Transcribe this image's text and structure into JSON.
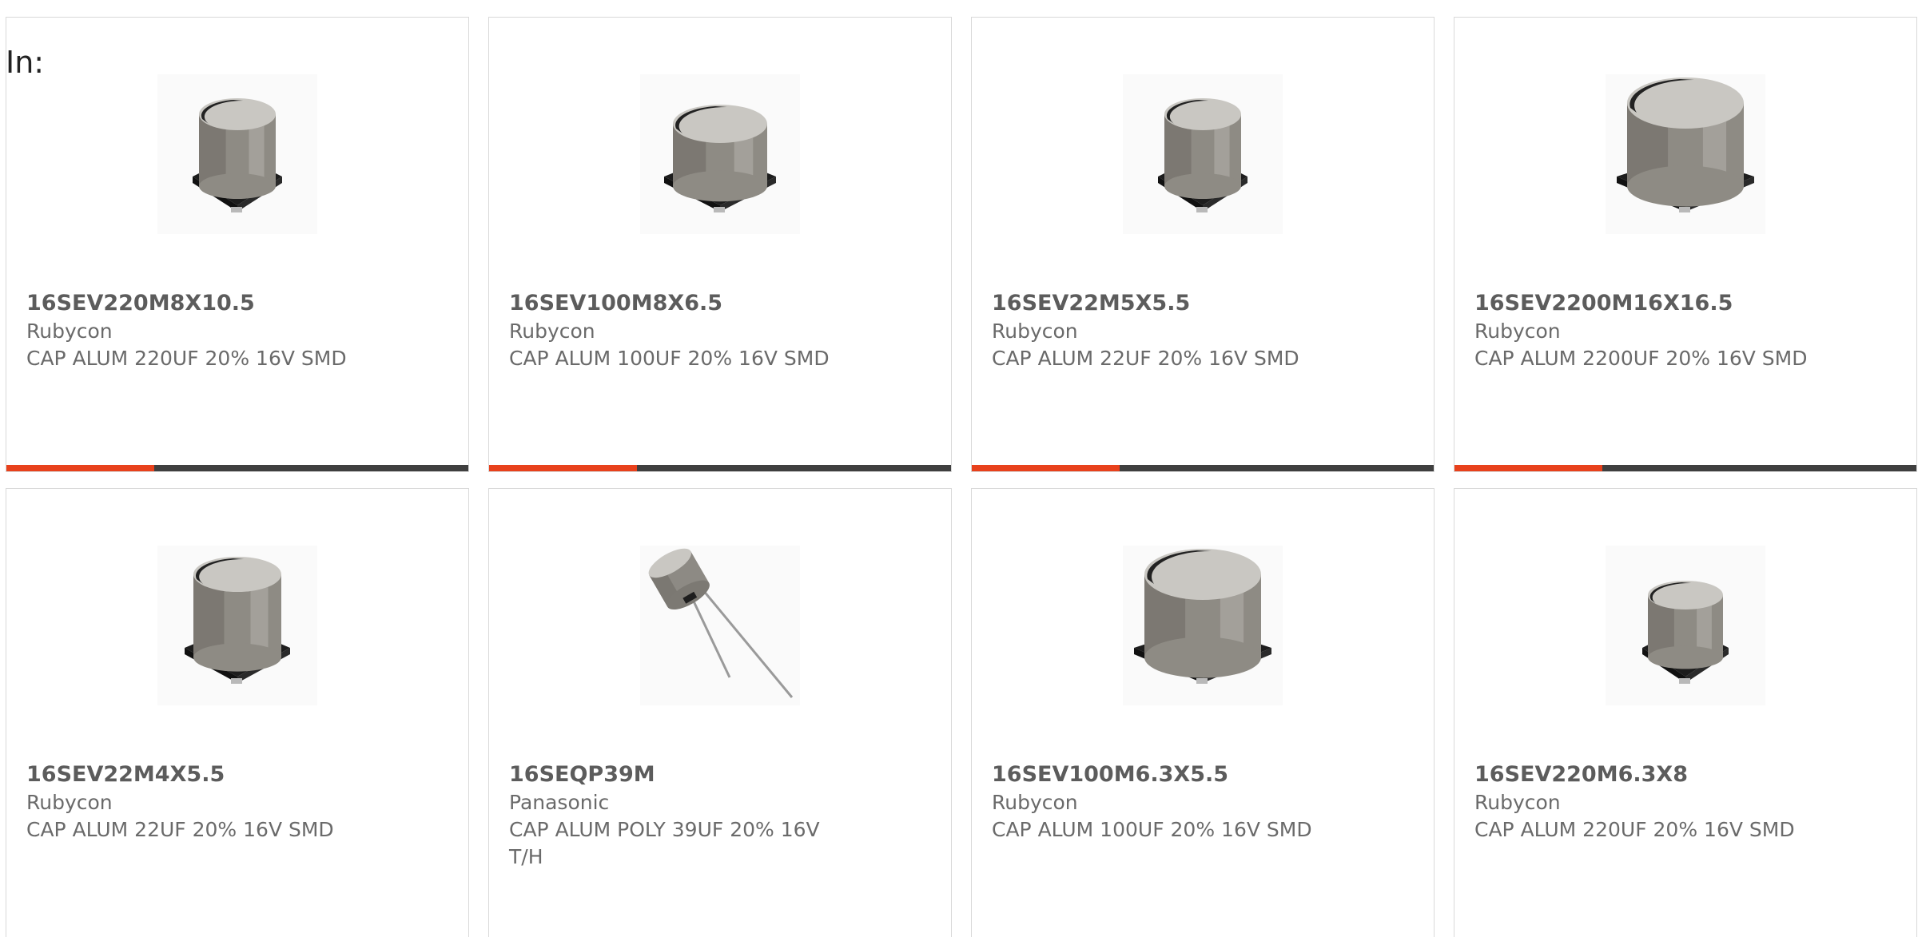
{
  "page": {
    "in_label": "In:"
  },
  "colors": {
    "accent": "#e8411c",
    "track": "#3f3f3f"
  },
  "products": [
    {
      "part": "16SEV220M8X10.5",
      "manufacturer": "Rubycon",
      "description": "CAP ALUM 220UF 20% 16V SMD",
      "image": "smd-capacitor-icon",
      "size": "medium",
      "progress": 0.32
    },
    {
      "part": "16SEV100M8X6.5",
      "manufacturer": "Rubycon",
      "description": "CAP ALUM 100UF 20% 16V SMD",
      "image": "smd-capacitor-icon",
      "size": "wide",
      "progress": 0.32
    },
    {
      "part": "16SEV22M5X5.5",
      "manufacturer": "Rubycon",
      "description": "CAP ALUM 22UF 20% 16V SMD",
      "image": "smd-capacitor-icon",
      "size": "medium",
      "progress": 0.32
    },
    {
      "part": "16SEV2200M16X16.5",
      "manufacturer": "Rubycon",
      "description": "CAP ALUM 2200UF 20% 16V SMD",
      "image": "smd-capacitor-icon",
      "size": "large",
      "progress": 0.32
    },
    {
      "part": "16SEV22M4X5.5",
      "manufacturer": "Rubycon",
      "description": "CAP ALUM 22UF 20% 16V SMD",
      "image": "smd-capacitor-icon",
      "size": "tall",
      "progress": null
    },
    {
      "part": "16SEQP39M",
      "manufacturer": "Panasonic",
      "description": "CAP ALUM POLY 39UF 20% 16V T/H",
      "image": "radial-capacitor-icon",
      "size": "radial",
      "progress": null
    },
    {
      "part": "16SEV100M6.3X5.5",
      "manufacturer": "Rubycon",
      "description": "CAP ALUM 100UF 20% 16V SMD",
      "image": "smd-capacitor-icon",
      "size": "large",
      "progress": null
    },
    {
      "part": "16SEV220M6.3X8",
      "manufacturer": "Rubycon",
      "description": "CAP ALUM 220UF 20% 16V SMD",
      "image": "smd-capacitor-icon",
      "size": "small",
      "progress": null
    }
  ]
}
